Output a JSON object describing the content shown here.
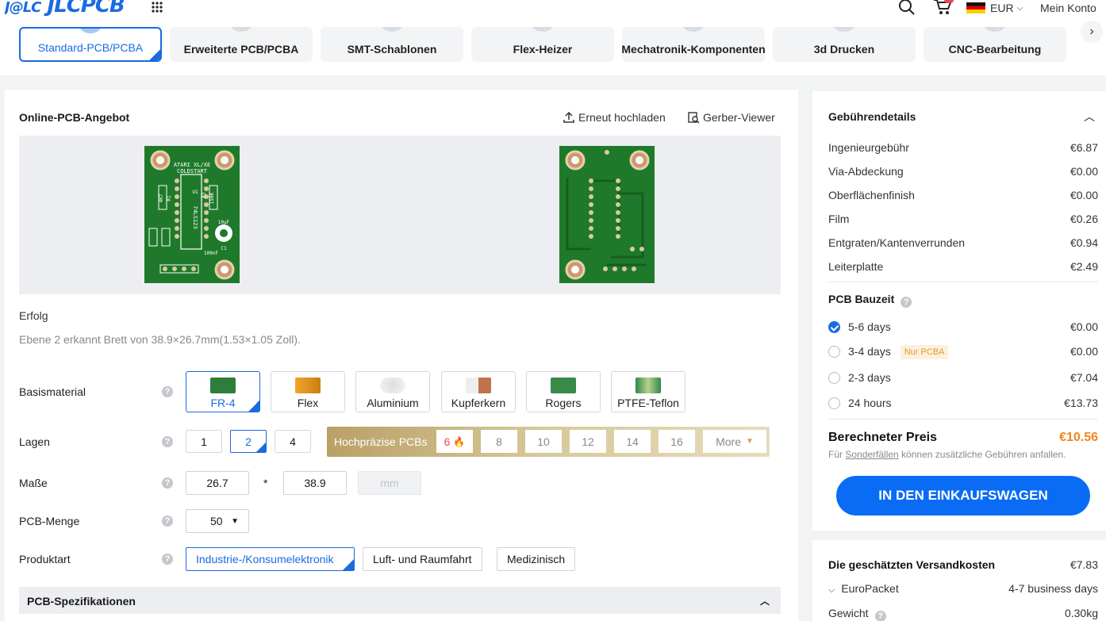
{
  "header": {
    "logo": "JLCPCB",
    "logo_prefix": "J@LC",
    "currency": "EUR",
    "account": "Mein Konto",
    "cart_badge": ""
  },
  "tabs": [
    {
      "label": "Standard-PCB/PCBA"
    },
    {
      "label": "Erweiterte PCB/PCBA"
    },
    {
      "label": "SMT-Schablonen"
    },
    {
      "label": "Flex-Heizer"
    },
    {
      "label": "Mechatronik-Komponenten"
    },
    {
      "label": "3d Drucken"
    },
    {
      "label": "CNC-Bearbeitung"
    }
  ],
  "main": {
    "title": "Online-PCB-Angebot",
    "reupload": "Erneut hochladen",
    "gerber": "Gerber-Viewer",
    "status": "Erfolg",
    "detected": "Ebene 2 erkannt Brett von 38.9×26.7mm(1.53×1.05 Zoll).",
    "pcb_top_text": [
      "ATARI XL/XE",
      "COLDSTART",
      "74LS123",
      "150K",
      "10µF",
      "100nF",
      "4K7",
      "R1",
      "R2",
      "U1",
      "C1"
    ]
  },
  "form": {
    "base_material": {
      "label": "Basismaterial",
      "options": [
        "FR-4",
        "Flex",
        "Aluminium",
        "Kupferkern",
        "Rogers",
        "PTFE-Teflon"
      ],
      "selected": "FR-4"
    },
    "layers": {
      "label": "Lagen",
      "options": [
        "1",
        "2",
        "4"
      ],
      "selected": "2",
      "hp_label": "Hochpräzise PCBs",
      "hp_options": [
        "6",
        "8",
        "10",
        "12",
        "14",
        "16"
      ],
      "more": "More"
    },
    "dimensions": {
      "label": "Maße",
      "width": "26.7",
      "times": "*",
      "height": "38.9",
      "unit": "mm"
    },
    "quantity": {
      "label": "PCB-Menge",
      "value": "50"
    },
    "product_type": {
      "label": "Produktart",
      "options": [
        "Industrie-/Konsumelektronik",
        "Luft- und Raumfahrt",
        "Medizinisch"
      ],
      "selected": "Industrie-/Konsumelektronik"
    },
    "specs": "PCB-Spezifikationen"
  },
  "fees": {
    "title": "Gebührendetails",
    "rows": [
      {
        "label": "Ingenieurgebühr",
        "value": "€6.87"
      },
      {
        "label": "Via-Abdeckung",
        "value": "€0.00"
      },
      {
        "label": "Oberflächenfinish",
        "value": "€0.00"
      },
      {
        "label": "Film",
        "value": "€0.26"
      },
      {
        "label": "Entgraten/Kantenverrunden",
        "value": "€0.94"
      },
      {
        "label": "Leiterplatte",
        "value": "€2.49"
      }
    ],
    "build_time": {
      "title": "PCB Bauzeit",
      "options": [
        {
          "label": "5-6 days",
          "value": "€0.00",
          "checked": true
        },
        {
          "label": "3-4 days",
          "value": "€0.00",
          "badge": "Nur PCBA"
        },
        {
          "label": "2-3 days",
          "value": "€7.04"
        },
        {
          "label": "24 hours",
          "value": "€13.73"
        }
      ]
    },
    "total_label": "Berechneter Preis",
    "total_value": "€10.56",
    "note_pre": "Für",
    "note_link": "Sonderfällen",
    "note_post": "können zusätzliche Gebühren anfallen.",
    "cart_button": "IN DEN EINKAUFSWAGEN"
  },
  "shipping": {
    "title": "Die geschätzten Versandkosten",
    "value": "€7.83",
    "method": "EuroPacket",
    "duration": "4-7 business days",
    "weight_label": "Gewicht",
    "weight_value": "0.30kg"
  },
  "colors": {
    "accent": "#1a6be0",
    "price": "#f5821f",
    "cart": "#0a6cf5",
    "pcb": "#1e7a2a"
  }
}
